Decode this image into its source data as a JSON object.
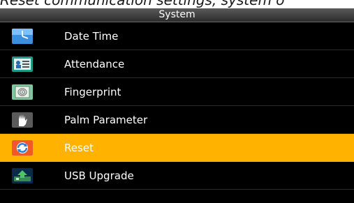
{
  "caption": "Reset communication settings, system o",
  "window": {
    "title": "System"
  },
  "menu": {
    "items": [
      {
        "label": "Date Time",
        "icon": "clock-icon",
        "selected": false
      },
      {
        "label": "Attendance",
        "icon": "attendance-icon",
        "selected": false
      },
      {
        "label": "Fingerprint",
        "icon": "fingerprint-icon",
        "selected": false
      },
      {
        "label": "Palm Parameter",
        "icon": "palm-icon",
        "selected": false
      },
      {
        "label": "Reset",
        "icon": "reset-icon",
        "selected": true
      },
      {
        "label": "USB Upgrade",
        "icon": "usb-upgrade-icon",
        "selected": false
      }
    ]
  },
  "colors": {
    "selected_bg": "#ffb300",
    "background": "#000000",
    "title_bg": "#3a3a3a"
  }
}
